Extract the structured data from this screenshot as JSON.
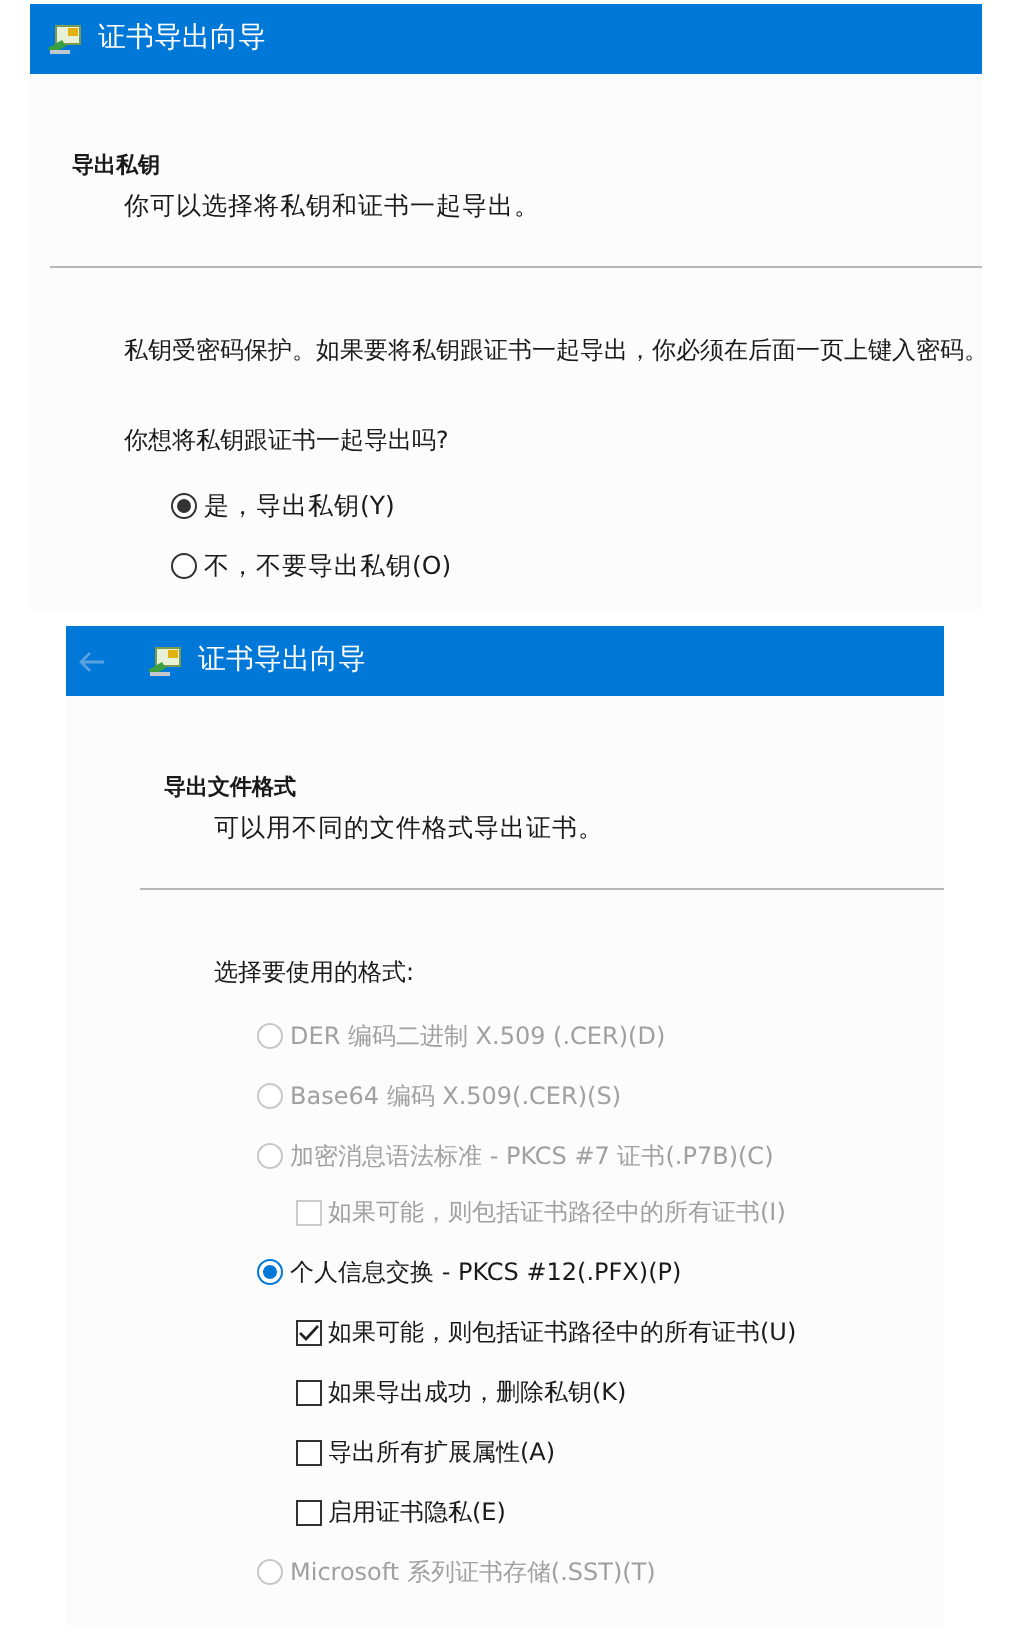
{
  "wizards": [
    {
      "title": "证书导出向导",
      "heading": "导出私钥",
      "description": "你可以选择将私钥和证书一起导出。",
      "body": [
        {
          "kind": "text",
          "text": "私钥受密码保护。如果要将私钥跟证书一起导出，你必须在后面一页上键入密码。"
        },
        {
          "kind": "text",
          "text": "你想将私钥跟证书一起导出吗?"
        },
        {
          "kind": "radio",
          "label": "是，导出私钥(Y)",
          "selected": true,
          "disabled": false
        },
        {
          "kind": "radio",
          "label": "不，不要导出私钥(O)",
          "selected": false,
          "disabled": false
        }
      ]
    },
    {
      "title": "证书导出向导",
      "back_button": {
        "disabled": true
      },
      "heading": "导出文件格式",
      "description": "可以用不同的文件格式导出证书。",
      "body": [
        {
          "kind": "text",
          "text": "选择要使用的格式:"
        },
        {
          "kind": "radio",
          "label": "DER 编码二进制 X.509 (.CER)(D)",
          "selected": false,
          "disabled": true
        },
        {
          "kind": "radio",
          "label": "Base64 编码 X.509(.CER)(S)",
          "selected": false,
          "disabled": true
        },
        {
          "kind": "radio",
          "label": "加密消息语法标准 - PKCS #7 证书(.P7B)(C)",
          "selected": false,
          "disabled": true,
          "children": [
            {
              "kind": "checkbox",
              "label": "如果可能，则包括证书路径中的所有证书(I)",
              "checked": false,
              "disabled": true
            }
          ]
        },
        {
          "kind": "radio",
          "label": "个人信息交换 - PKCS #12(.PFX)(P)",
          "selected": true,
          "disabled": false,
          "children": [
            {
              "kind": "checkbox",
              "label": "如果可能，则包括证书路径中的所有证书(U)",
              "checked": true,
              "disabled": false
            },
            {
              "kind": "checkbox",
              "label": "如果导出成功，删除私钥(K)",
              "checked": false,
              "disabled": false
            },
            {
              "kind": "checkbox",
              "label": "导出所有扩展属性(A)",
              "checked": false,
              "disabled": false
            },
            {
              "kind": "checkbox",
              "label": "启用证书隐私(E)",
              "checked": false,
              "disabled": false
            }
          ]
        },
        {
          "kind": "radio",
          "label": "Microsoft 系列证书存储(.SST)(T)",
          "selected": false,
          "disabled": true
        }
      ]
    }
  ]
}
